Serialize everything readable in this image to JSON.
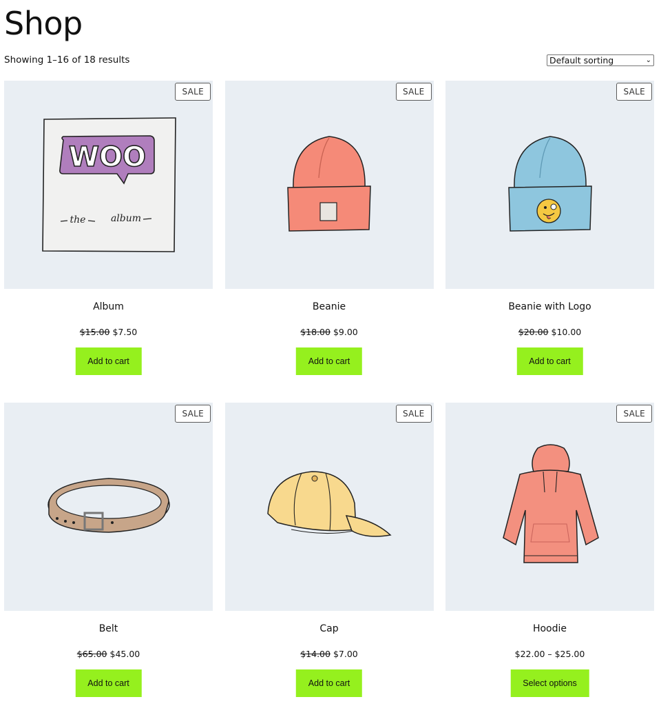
{
  "page": {
    "title": "Shop",
    "result_count": "Showing 1–16 of 18 results",
    "sorting": {
      "selected": "Default sorting"
    }
  },
  "colors": {
    "thumb_bg": "#e9eef3",
    "button_bg": "#95f01e"
  },
  "products": [
    {
      "name": "Album",
      "old_price": "$15.00",
      "price": "$7.50",
      "badge": "SALE",
      "button": "Add to cart",
      "image": "album-art"
    },
    {
      "name": "Beanie",
      "old_price": "$18.00",
      "price": "$9.00",
      "badge": "SALE",
      "button": "Add to cart",
      "image": "beanie"
    },
    {
      "name": "Beanie with Logo",
      "old_price": "$20.00",
      "price": "$10.00",
      "badge": "SALE",
      "button": "Add to cart",
      "image": "beanie-logo"
    },
    {
      "name": "Belt",
      "old_price": "$65.00",
      "price": "$45.00",
      "badge": "SALE",
      "button": "Add to cart",
      "image": "belt"
    },
    {
      "name": "Cap",
      "old_price": "$14.00",
      "price": "$7.00",
      "badge": "SALE",
      "button": "Add to cart",
      "image": "cap"
    },
    {
      "name": "Hoodie",
      "old_price": "",
      "price": "$22.00 – $25.00",
      "badge": "SALE",
      "button": "Select options",
      "image": "hoodie"
    }
  ],
  "album_art": {
    "logo_text": "WOO",
    "caption_left": "the",
    "caption_right": "album"
  }
}
